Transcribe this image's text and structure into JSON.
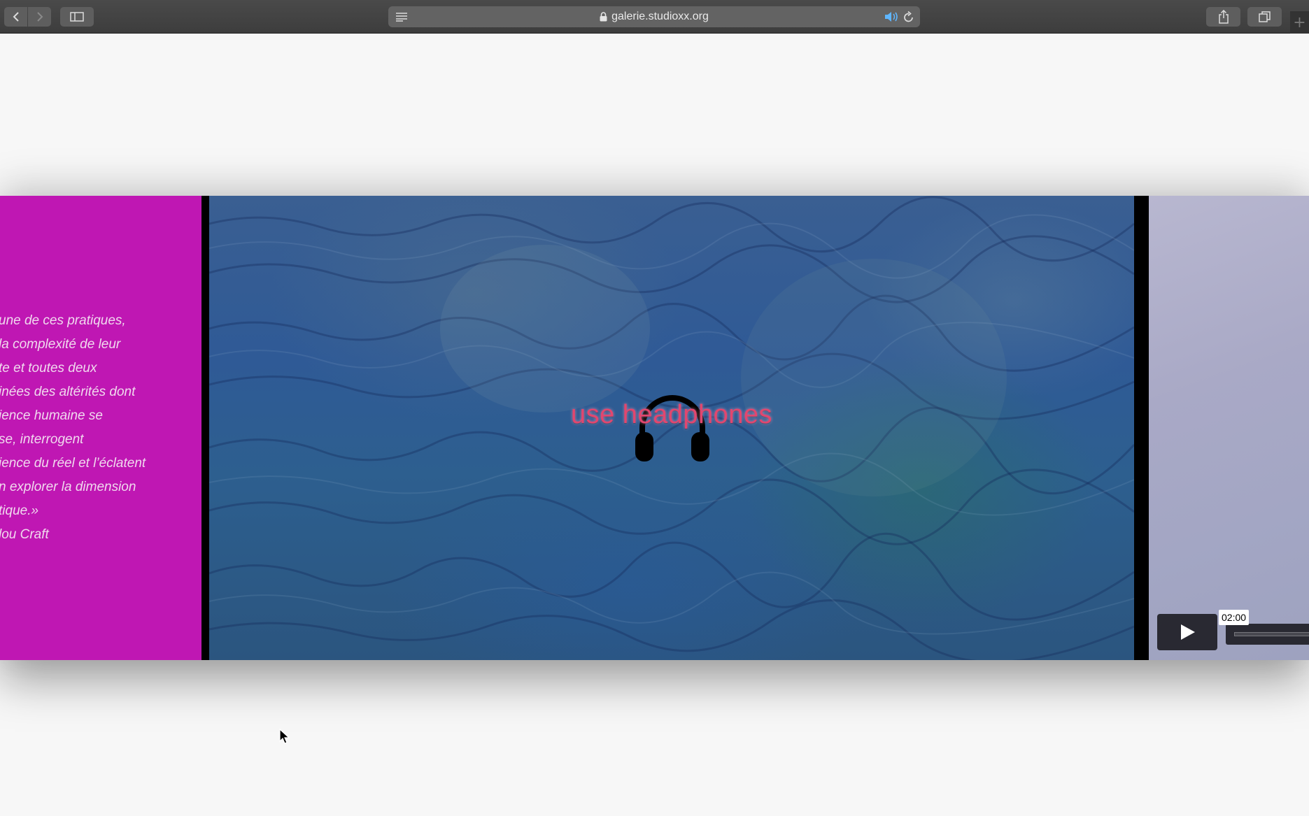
{
  "browser": {
    "url": "galerie.studioxx.org",
    "icons": {
      "back": "chevron-left-icon",
      "forward": "chevron-right-icon",
      "sidebar": "sidebar-icon",
      "reader": "reader-icon",
      "lock": "lock-icon",
      "audio": "speaker-icon",
      "reload": "reload-icon",
      "share": "share-icon",
      "tabs": "tabs-icon",
      "new_tab": "plus-icon"
    },
    "new_tab_label": "+"
  },
  "artwork_text": {
    "lines": [
      "une de ces pratiques,",
      " la complexité de leur",
      "te et toutes deux",
      "inées des altérités dont",
      "ience humaine se",
      "se, interrogent",
      "ience du réel et l’éclatent",
      "n explorer la dimension",
      "tique.»",
      "lou Craft"
    ],
    "background_color": "#bf17b3"
  },
  "main_video": {
    "overlay_text": "use headphones",
    "overlay_color": "#e2466f",
    "icon": "headphones-icon"
  },
  "side_video": {
    "play_icon": "play-icon",
    "time_tooltip": "02:00"
  }
}
